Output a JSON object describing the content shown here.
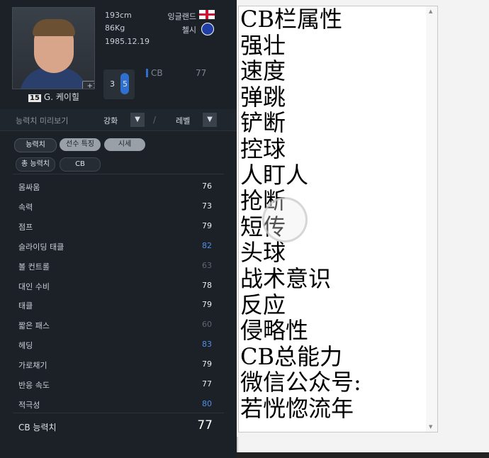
{
  "player": {
    "height": "193cm",
    "weight": "86Kg",
    "birthdate": "1985.12.19",
    "nation": "잉글랜드",
    "club": "첼시",
    "number": "15",
    "name": "G. 케이힐",
    "upgrade_badge": "+1",
    "weak_foot_left": "3",
    "weak_foot_right": "5",
    "position": "CB",
    "position_rating": "77"
  },
  "preview": {
    "label": "능력치 미리보기",
    "enhance_label": "강화",
    "level_label": "레벨",
    "separator": "/"
  },
  "tabs": [
    "능력치",
    "선수 특징",
    "시세"
  ],
  "subtabs": [
    "총 능력치",
    "CB"
  ],
  "stats": [
    {
      "label": "몸싸움",
      "value": "76",
      "style": "normal"
    },
    {
      "label": "속력",
      "value": "73",
      "style": "normal"
    },
    {
      "label": "점프",
      "value": "79",
      "style": "normal"
    },
    {
      "label": "슬라이딩 태클",
      "value": "82",
      "style": "blue"
    },
    {
      "label": "볼 컨트롤",
      "value": "63",
      "style": "dim"
    },
    {
      "label": "대인 수비",
      "value": "78",
      "style": "normal"
    },
    {
      "label": "태클",
      "value": "79",
      "style": "normal"
    },
    {
      "label": "짧은 패스",
      "value": "60",
      "style": "dim"
    },
    {
      "label": "헤딩",
      "value": "83",
      "style": "blue"
    },
    {
      "label": "가로채기",
      "value": "79",
      "style": "normal"
    },
    {
      "label": "반응 속도",
      "value": "77",
      "style": "normal"
    },
    {
      "label": "적극성",
      "value": "80",
      "style": "blue"
    }
  ],
  "total": {
    "label": "CB 능력치",
    "value": "77"
  },
  "textbox_lines": [
    "CB栏属性",
    "强壮",
    "速度",
    "弹跳",
    "铲断",
    "控球",
    "人盯人",
    "抢断",
    "短传",
    "头球",
    "战术意识",
    "反应",
    "侵略性",
    "CB总能力",
    "微信公众号:",
    "若恍惚流年"
  ],
  "colors": {
    "panel_bg": "#1c2128",
    "accent_blue": "#4f8fe6",
    "dim_value": "#5f6670"
  }
}
